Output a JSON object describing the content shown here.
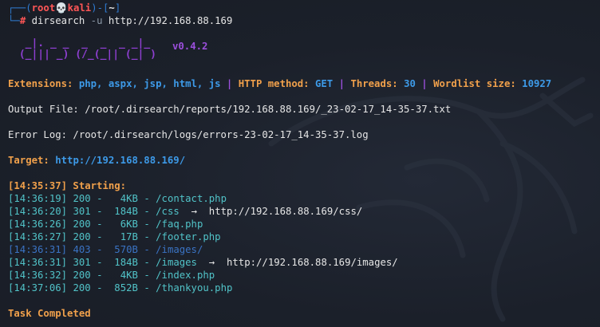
{
  "prompt": {
    "open": "┌──(",
    "user": "root",
    "skull": "💀",
    "host": "kali",
    "close": ")-[",
    "dir": "~",
    "end": "]",
    "line2": "└─",
    "hash": "#",
    "command": "dirsearch",
    "flag": "-u",
    "url": "http://192.168.88.169"
  },
  "banner": {
    "logo_lines": [
      "  _|. _ _  _  _  _ _|_",
      " (_||| _) (/_(_|| (_| )"
    ],
    "version": "v0.4.2"
  },
  "config": {
    "ext_label": "Extensions:",
    "ext_value": "php, aspx, jsp, html, js",
    "sep": " | ",
    "method_label": "HTTP method:",
    "method_value": "GET",
    "threads_label": "Threads:",
    "threads_value": "30",
    "wordlist_label": "Wordlist size:",
    "wordlist_value": "10927"
  },
  "output_file": "Output File: /root/.dirsearch/reports/192.168.88.169/_23-02-17_14-35-37.txt",
  "error_log": "Error Log: /root/.dirsearch/logs/errors-23-02-17_14-35-37.log",
  "target": {
    "label": "Target:",
    "url": "http://192.168.88.169/"
  },
  "starting": "[14:35:37] Starting:",
  "results": [
    {
      "time": "[14:36:19]",
      "status": "200",
      "size": "  4KB",
      "path": "/contact.php",
      "redirect": ""
    },
    {
      "time": "[14:36:20]",
      "status": "301",
      "size": " 184B",
      "path": "/css",
      "redirect": "http://192.168.88.169/css/"
    },
    {
      "time": "[14:36:26]",
      "status": "200",
      "size": "  6KB",
      "path": "/faq.php",
      "redirect": ""
    },
    {
      "time": "[14:36:27]",
      "status": "200",
      "size": "  17B",
      "path": "/footer.php",
      "redirect": ""
    },
    {
      "time": "[14:36:31]",
      "status": "403",
      "size": " 570B",
      "path": "/images/",
      "redirect": ""
    },
    {
      "time": "[14:36:31]",
      "status": "301",
      "size": " 184B",
      "path": "/images",
      "redirect": "http://192.168.88.169/images/"
    },
    {
      "time": "[14:36:32]",
      "status": "200",
      "size": "  4KB",
      "path": "/index.php",
      "redirect": ""
    },
    {
      "time": "[14:37:06]",
      "status": "200",
      "size": " 852B",
      "path": "/thankyou.php",
      "redirect": ""
    }
  ],
  "redirect_arrow": "→",
  "completed": "Task Completed",
  "colors": {
    "background": "#1b202a",
    "orange": "#f0a04b",
    "blue": "#3d9ae8",
    "purple": "#9b4fdc",
    "teal": "#51c3c8",
    "red": "#ff5656"
  }
}
